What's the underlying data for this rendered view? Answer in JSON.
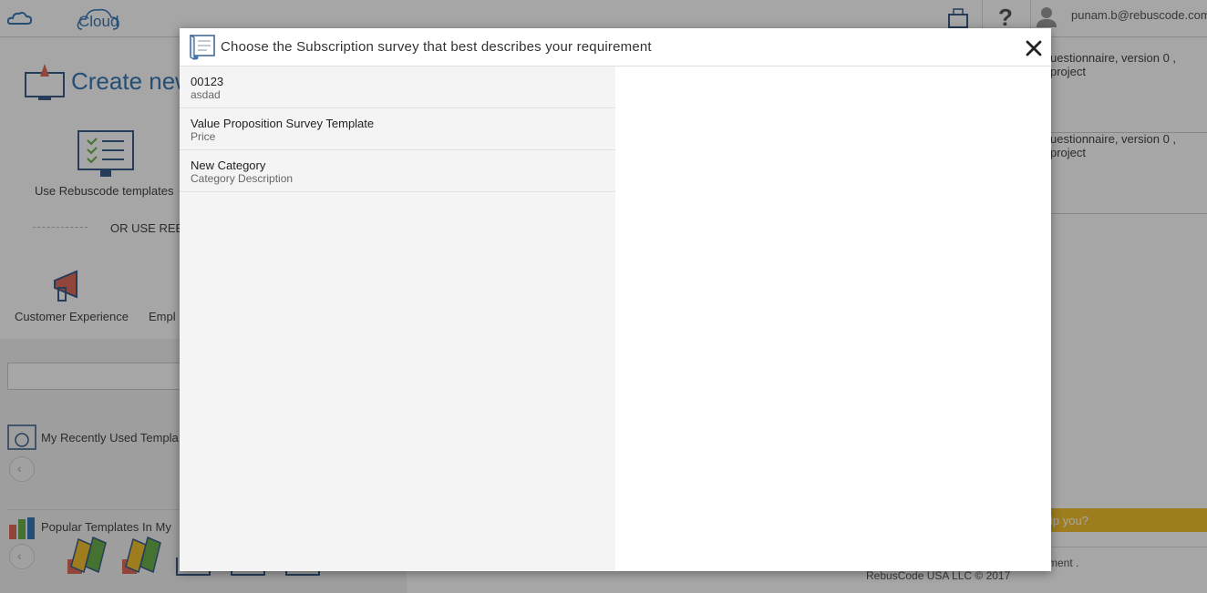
{
  "header": {
    "logo_text": "Cloud",
    "help_label": "?",
    "user_email": "punam.b@rebuscode.com"
  },
  "main": {
    "create_title": "Create new",
    "use_templates_label": "Use Rebuscode templates",
    "or_use_label": "OR USE REB",
    "categories": [
      "Customer Experience",
      "Empl"
    ],
    "recent_label": "My Recently Used Templa",
    "popular_label": "Popular Templates In My",
    "nav_prev_label": "‹"
  },
  "right_panel": {
    "items": [
      {
        "line1": "uestionnaire, version 0 ,",
        "line2": "project"
      },
      {
        "line1": "uestionnaire, version 0 ,",
        "line2": "project"
      }
    ],
    "help_text": "lp you?",
    "footer_text": "ment .",
    "copyright": "RebusCode USA LLC © 2017"
  },
  "modal": {
    "title": "Choose the Subscription survey that best describes your requirement",
    "close_label": "✕",
    "items": [
      {
        "title": "00123",
        "subtitle": "asdad"
      },
      {
        "title": "Value Proposition Survey Template",
        "subtitle": "Price"
      },
      {
        "title": "New Category",
        "subtitle": "Category Description"
      }
    ]
  },
  "colors": {
    "brand_blue": "#3a78b5",
    "help_bar": "#f2c12e",
    "overlay": "rgba(0,0,0,0.35)"
  }
}
